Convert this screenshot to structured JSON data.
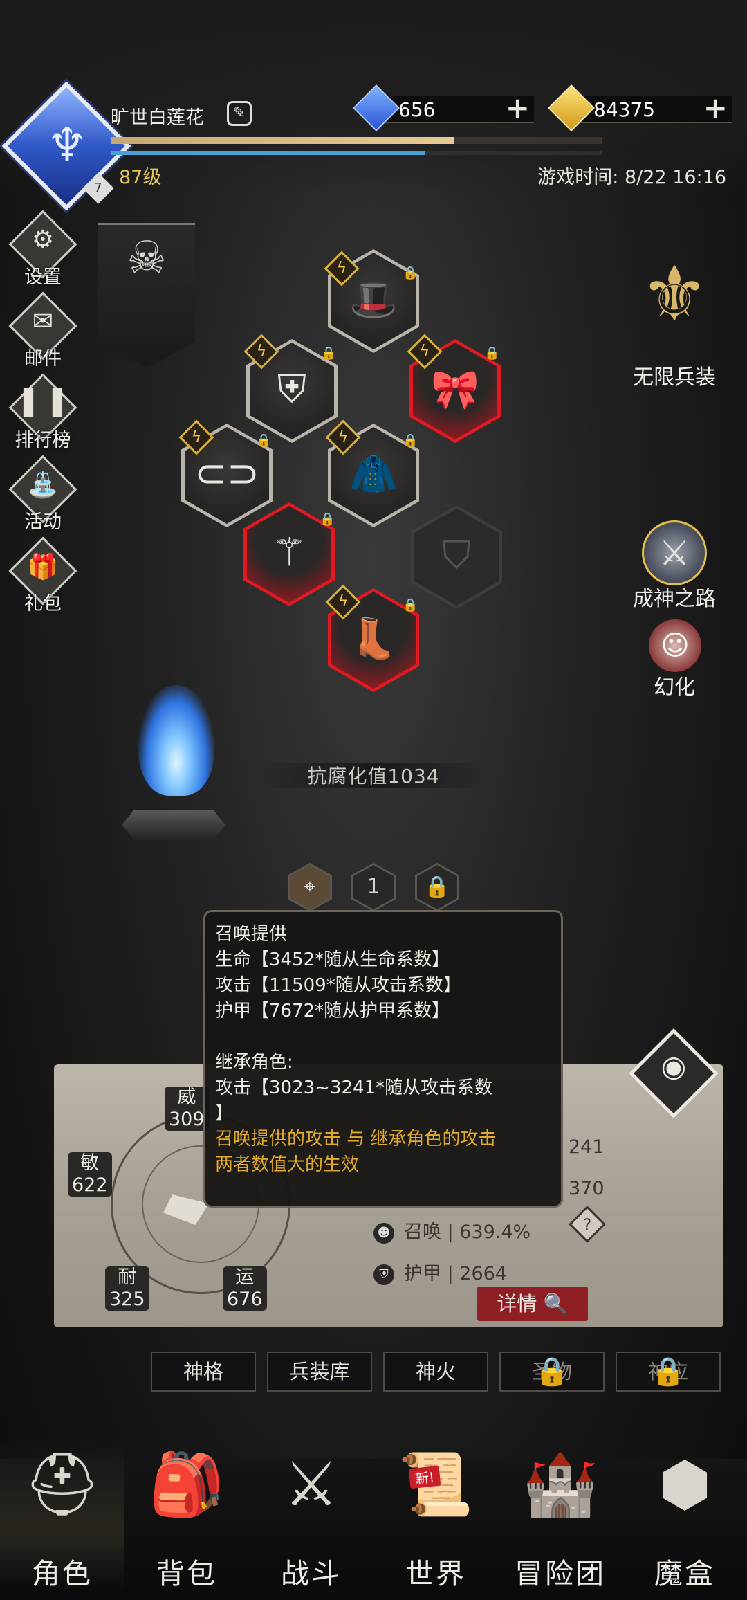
{
  "player": {
    "name": "旷世白莲花",
    "level": "87级",
    "rank_badge": "7",
    "exp_fraction": 0.7,
    "mp_fraction": 0.64
  },
  "currency": {
    "gems": "656",
    "gold": "84375"
  },
  "game_time": "游戏时间: 8/22 16:16",
  "side_menu": [
    {
      "label": "设置",
      "icon": "gear-icon"
    },
    {
      "label": "邮件",
      "icon": "mail-icon"
    },
    {
      "label": "排行榜",
      "icon": "leaderboard-icon"
    },
    {
      "label": "活动",
      "icon": "event-icon"
    },
    {
      "label": "礼包",
      "icon": "gift-icon"
    }
  ],
  "right_features": {
    "infinite_arms": "无限兵装",
    "godhood_path": "成神之路",
    "transform": "幻化"
  },
  "corruption": "抗腐化值1034",
  "page_selector": {
    "current": "1"
  },
  "tooltip": {
    "line1": "召唤提供",
    "line2": "生命【3452*随从生命系数】",
    "line3": "攻击【11509*随从攻击系数】",
    "line4": "护甲【7672*随从护甲系数】",
    "line5": "继承角色:",
    "line6": "攻击【3023~3241*随从攻击系数",
    "line7": "】",
    "highlight1": "召唤提供的攻击 与 继承角色的攻击",
    "highlight2": "两者数值大的生效"
  },
  "stats": {
    "radar": {
      "wei": "威",
      "wei_val": "309",
      "min": "敏",
      "min_val": "622",
      "nai": "耐",
      "nai_val": "325",
      "yun": "运",
      "yun_val": "676"
    },
    "row1_val": "241",
    "row2_val": "370",
    "summon": "召唤 | 639.4%",
    "armor": "护甲 | 2664",
    "detail_button": "详情"
  },
  "sub_tabs": [
    "神格",
    "兵装库",
    "神火",
    "圣物",
    "神应"
  ],
  "bottom_nav": [
    {
      "label": "角色"
    },
    {
      "label": "背包"
    },
    {
      "label": "战斗"
    },
    {
      "label": "世界",
      "badge": "新!"
    },
    {
      "label": "冒险团"
    },
    {
      "label": "魔盒"
    }
  ],
  "colors": {
    "gold_text": "#e5c55e",
    "tooltip_highlight": "#e2aa2a",
    "red_slot": "#e01a22",
    "detail_button": "#8e2025"
  }
}
